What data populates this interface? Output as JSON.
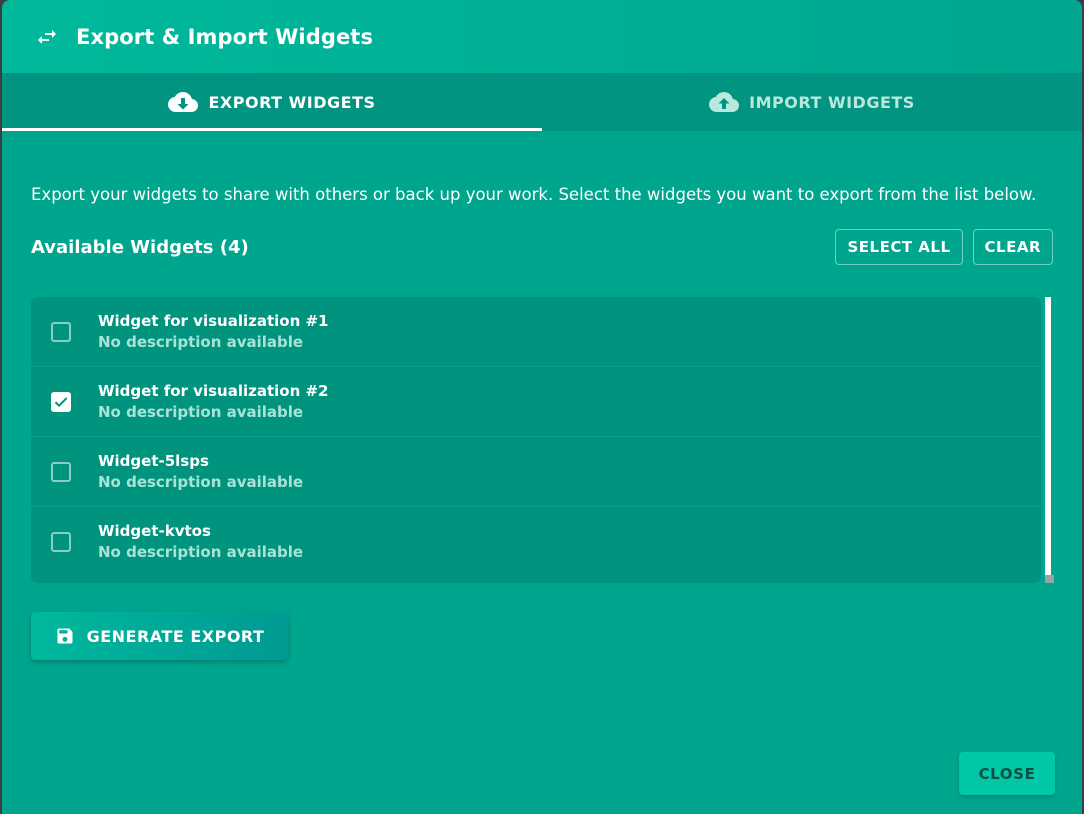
{
  "dialog": {
    "title": "Export & Import Widgets",
    "title_icon": "swap-horizontal-icon"
  },
  "tabs": [
    {
      "label": "EXPORT WIDGETS",
      "icon": "cloud-download-icon",
      "active": true
    },
    {
      "label": "IMPORT WIDGETS",
      "icon": "cloud-upload-icon",
      "active": false
    }
  ],
  "export": {
    "description": "Export your widgets to share with others or back up your work. Select the widgets you want to export from the list below.",
    "available_title": "Available Widgets (4)",
    "select_all_label": "SELECT ALL",
    "clear_label": "CLEAR",
    "widgets": [
      {
        "name": "Widget for visualization #1",
        "description": "No description available",
        "checked": false
      },
      {
        "name": "Widget for visualization #2",
        "description": "No description available",
        "checked": true
      },
      {
        "name": "Widget-5lsps",
        "description": "No description available",
        "checked": false
      },
      {
        "name": "Widget-kvtos",
        "description": "No description available",
        "checked": false
      }
    ],
    "generate_label": "GENERATE EXPORT",
    "generate_icon": "floppy-disk-icon"
  },
  "footer": {
    "close_label": "CLOSE"
  },
  "colors": {
    "dialog_bg": "#00a58e",
    "header_bg": "#00b99b",
    "tabs_bg": "#009481",
    "list_bg": "#00937e",
    "close_bg": "#00c8a6"
  }
}
